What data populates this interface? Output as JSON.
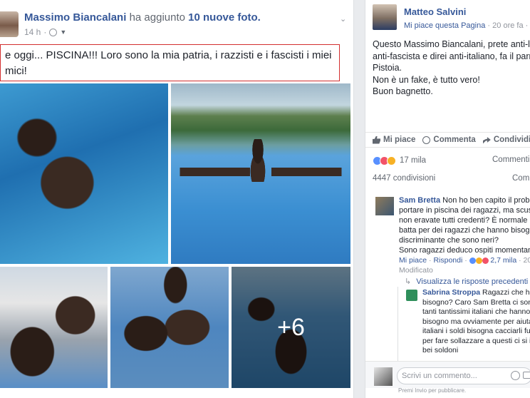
{
  "post": {
    "author": "Massimo Biancalani",
    "action": "ha aggiunto",
    "photo_count": "10 nuove foto.",
    "time": "14 h",
    "text_line1": "e oggi... PISCINA!!! Loro sono la mia patria, i razzisti e i fascisti i miei",
    "text_line2": "mici!",
    "more_photos": "+6"
  },
  "shared": {
    "author": "Matteo Salvini",
    "like_link": "Mi piace questa Pagina",
    "time": "20 ore fa",
    "lines": [
      "Questo Massimo Biancalani, prete anti-leghi",
      "anti-fascista e direi anti-italiano, fa il parroco",
      "Pistoia.",
      "Non è un fake, è tutto vero!",
      "Buon bagnetto."
    ],
    "actions": {
      "like": "Mi piace",
      "comment": "Commenta",
      "share": "Condividi"
    },
    "reaction_count": "17 mila",
    "comments_link": "Commenti pi",
    "shares": "4447 condivisioni",
    "comments_short": "Comme",
    "comment1": {
      "name": "Sam Bretta",
      "lines": [
        "Non ho ben capito il problema",
        "portare in piscina dei ragazzi, ma scusate u",
        "non eravate tutti credenti? È normale un pr",
        "batta per dei ragazzi che hanno bisogno, o",
        "discriminante che sono neri?",
        "Sono ragazzi deduco ospiti momentanea...."
      ],
      "like": "Mi piace",
      "reply": "Rispondi",
      "reactions": "2,7 mila",
      "time": "20 h",
      "edited": "Modificato"
    },
    "view_replies": "Visualizza le risposte precedenti",
    "reply1": {
      "name": "Sabrina Stroppa",
      "lines": [
        "Ragazzi che hanno",
        "bisogno? Caro Sam Bretta ci sono tar",
        "tanti tantissimi italiani che hanno molt",
        "bisogno ma ovviamente per aiutare gl",
        "italiani i soldi bisogna cacciarli fuori m",
        "per fare sollazzare a questi ci si intasca",
        "bei soldoni"
      ]
    },
    "write_placeholder": "Scrivi un commento...",
    "press_note": "Premi Invio per pubblicare."
  },
  "colors": {
    "link": "#365899",
    "highlight_border": "#d32f2f",
    "like_blue": "#5890ff"
  }
}
